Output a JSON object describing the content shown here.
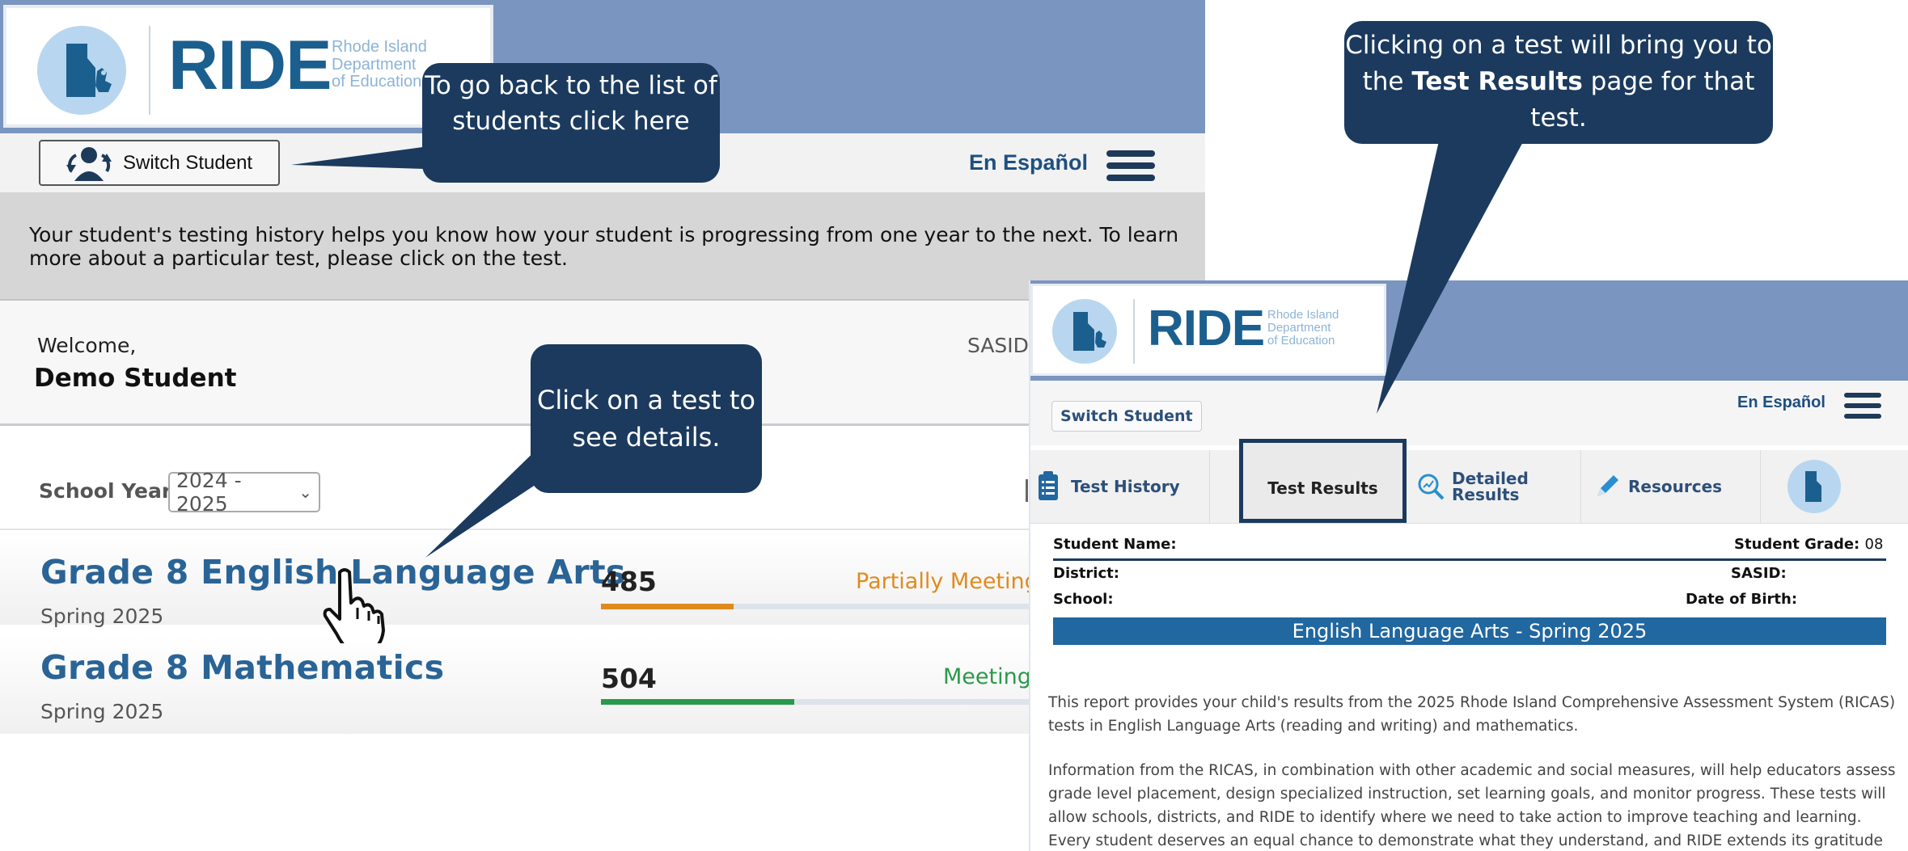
{
  "left": {
    "logo": {
      "word": "RIDE",
      "line1": "Rhode Island",
      "line2": "Department",
      "line3": "of Education"
    },
    "toolbar": {
      "switch_label": "Switch Student",
      "espanol": "En Español"
    },
    "info_text": "Your student's testing history helps you know how your student is progressing from one year to the next. To learn more about a particular test, please click on the test.",
    "welcome": {
      "label": "Welcome,",
      "name": "Demo Student",
      "sasid": "SASID"
    },
    "school_year": {
      "label": "School Year",
      "selected": "2024 - 2025"
    },
    "tests": [
      {
        "title": "Grade 8 English Language Arts",
        "term": "Spring 2025",
        "score": "485",
        "level": "Partially Meeting",
        "level_color": "#e08a1e",
        "progress": 0.22
      },
      {
        "title": "Grade 8 Mathematics",
        "term": "Spring 2025",
        "score": "504",
        "level": "Meeting",
        "level_color": "#2a9a4a",
        "progress": 0.32
      }
    ]
  },
  "right": {
    "logo": {
      "word": "RIDE",
      "line1": "Rhode Island",
      "line2": "Department",
      "line3": "of Education"
    },
    "switch_label": "Switch Student",
    "espanol": "En Español",
    "tabs": [
      {
        "label": "Test History",
        "icon": "clipboard-icon"
      },
      {
        "label": "Test Results",
        "icon": ""
      },
      {
        "label_1": "Detailed",
        "label_2": "Results",
        "icon": "magnifier-chart-icon"
      },
      {
        "label": "Resources",
        "icon": "pencil-icon"
      }
    ],
    "info": {
      "student_name": "Student Name:",
      "student_grade_label": "Student Grade:",
      "student_grade_value": "08",
      "district": "District:",
      "sasid": "SASID:",
      "school": "School:",
      "dob": "Date of Birth:"
    },
    "title_bar": "English Language Arts - Spring 2025",
    "para1": "This report provides your child's results from the 2025 Rhode Island Comprehensive Assessment System (RICAS) tests in English Language Arts (reading and writing) and mathematics.",
    "para2": "Information from the RICAS, in combination with other academic and social measures, will help educators assess grade level placement, design specialized instruction, set learning goals, and monitor progress. These tests will allow schools, districts, and RIDE to identify where we need to take action to improve teaching and learning. Every student deserves an equal chance to demonstrate what they understand, and RIDE extends its gratitude to our"
  },
  "callouts": {
    "back": "To go back to the list of students click here",
    "click": "Click on a test to see details.",
    "results_pre": "Clicking on a test will bring you to the ",
    "results_bold": "Test Results",
    "results_post": " page for that test."
  },
  "colors": {
    "navy": "#1b3a5e",
    "band": "#7a95bf",
    "brand": "#1b5f8f",
    "link": "#2a6496"
  }
}
